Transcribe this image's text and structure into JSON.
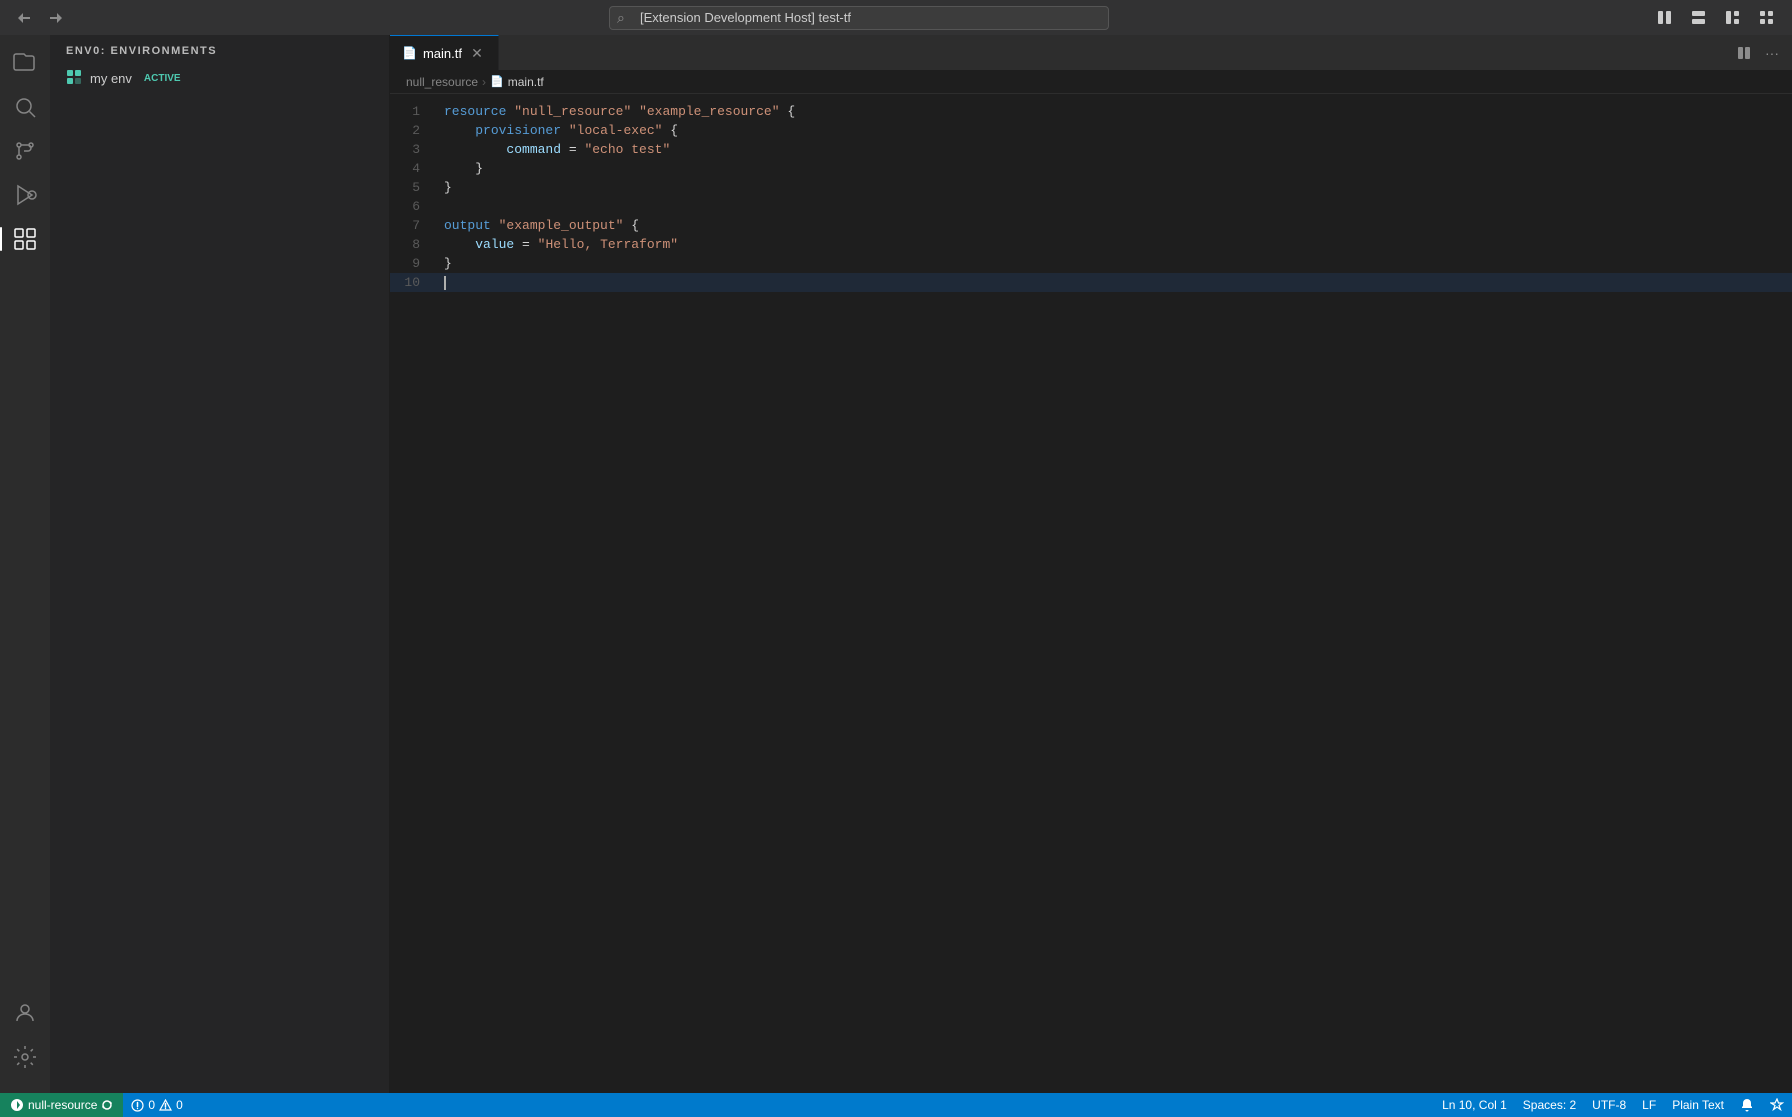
{
  "titlebar": {
    "back_label": "←",
    "forward_label": "→",
    "search_placeholder": "[Extension Development Host] test-tf",
    "search_value": "[Extension Development Host] test-tf",
    "layout_btn1": "⊞",
    "layout_btn2": "⊟",
    "layout_btn3": "⊠",
    "layout_btn4": "⋮⊞"
  },
  "sidebar": {
    "header": "ENV0: ENVIRONMENTS",
    "items": [
      {
        "name": "my env",
        "badge": "ACTIVE"
      }
    ]
  },
  "editor": {
    "tab_label": "main.tf",
    "breadcrumb_folder": "null_resource",
    "breadcrumb_file": "main.tf",
    "lines": [
      {
        "num": 1,
        "content": "resource \"null_resource\" \"example_resource\" {",
        "tokens": [
          {
            "type": "kw",
            "text": "resource"
          },
          {
            "type": "op",
            "text": " "
          },
          {
            "type": "str",
            "text": "\"null_resource\""
          },
          {
            "type": "op",
            "text": " "
          },
          {
            "type": "str",
            "text": "\"example_resource\""
          },
          {
            "type": "op",
            "text": " {"
          }
        ]
      },
      {
        "num": 2,
        "content": "    provisioner \"local-exec\" {",
        "tokens": [
          {
            "type": "op",
            "text": "    "
          },
          {
            "type": "kw",
            "text": "provisioner"
          },
          {
            "type": "op",
            "text": " "
          },
          {
            "type": "str",
            "text": "\"local-exec\""
          },
          {
            "type": "op",
            "text": " {"
          }
        ]
      },
      {
        "num": 3,
        "content": "        command = \"echo test\"",
        "tokens": [
          {
            "type": "op",
            "text": "        "
          },
          {
            "type": "ident",
            "text": "command"
          },
          {
            "type": "op",
            "text": " = "
          },
          {
            "type": "str",
            "text": "\"echo test\""
          }
        ]
      },
      {
        "num": 4,
        "content": "    }",
        "tokens": [
          {
            "type": "op",
            "text": "    }"
          }
        ]
      },
      {
        "num": 5,
        "content": "}",
        "tokens": [
          {
            "type": "op",
            "text": "}"
          }
        ]
      },
      {
        "num": 6,
        "content": "",
        "tokens": []
      },
      {
        "num": 7,
        "content": "output \"example_output\" {",
        "tokens": [
          {
            "type": "kw",
            "text": "output"
          },
          {
            "type": "op",
            "text": " "
          },
          {
            "type": "str",
            "text": "\"example_output\""
          },
          {
            "type": "op",
            "text": " {"
          }
        ]
      },
      {
        "num": 8,
        "content": "    value = \"Hello, Terraform\"",
        "tokens": [
          {
            "type": "op",
            "text": "    "
          },
          {
            "type": "ident",
            "text": "value"
          },
          {
            "type": "op",
            "text": " = "
          },
          {
            "type": "str",
            "text": "\"Hello, Terraform\""
          }
        ]
      },
      {
        "num": 9,
        "content": "}",
        "tokens": [
          {
            "type": "op",
            "text": "}"
          }
        ]
      },
      {
        "num": 10,
        "content": "",
        "tokens": [],
        "cursor": true
      }
    ]
  },
  "statusbar": {
    "remote_icon": "⇄",
    "remote_label": "null-resource",
    "sync_icon": "↻",
    "error_icon": "⊗",
    "error_count": "0",
    "warning_icon": "⚠",
    "warning_count": "0",
    "position": "Ln 10, Col 1",
    "spaces": "Spaces: 2",
    "encoding": "UTF-8",
    "line_ending": "LF",
    "language": "Plain Text",
    "notifications_icon": "🔔",
    "feedback_icon": "⚑"
  },
  "activity": {
    "items": [
      {
        "icon": "⊞",
        "name": "extensions-icon",
        "label": "Extensions"
      },
      {
        "icon": "⚲",
        "name": "search-icon",
        "label": "Search"
      },
      {
        "icon": "⑂",
        "name": "source-control-icon",
        "label": "Source Control"
      },
      {
        "icon": "▷",
        "name": "run-icon",
        "label": "Run and Debug"
      },
      {
        "icon": "⊟",
        "name": "plugins-icon",
        "label": "Extensions Active",
        "active": true
      }
    ],
    "bottom": [
      {
        "icon": "👤",
        "name": "account-icon",
        "label": "Account"
      },
      {
        "icon": "⚙",
        "name": "settings-icon",
        "label": "Settings"
      }
    ]
  }
}
